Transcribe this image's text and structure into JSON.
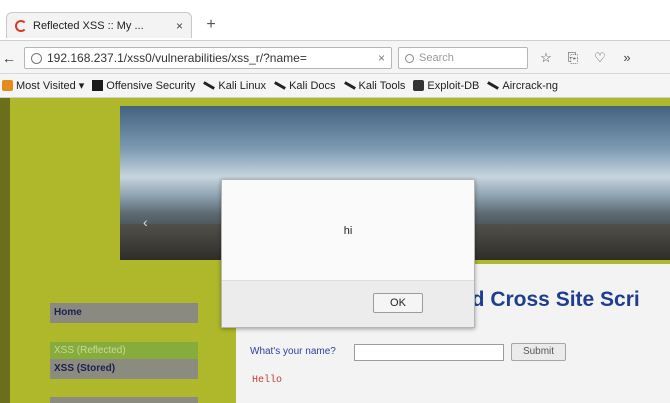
{
  "browser": {
    "tab_title": "Reflected XSS :: My ...",
    "tab_close": "×",
    "new_tab": "+",
    "url": "192.168.237.1/xss0/vulnerabilities/xss_r/?name=",
    "url_clear": "×",
    "search_placeholder": "Search",
    "back": "←",
    "icons": [
      "star-icon",
      "clipboard-icon",
      "pocket-icon",
      "overflow-icon"
    ],
    "icon_glyphs": [
      "☆",
      "⎘",
      "♡",
      "»"
    ]
  },
  "bookmarks": [
    {
      "label": "Most Visited ▾",
      "icon": "most-visited-icon"
    },
    {
      "label": "Offensive Security",
      "icon": "offensive-security-icon"
    },
    {
      "label": "Kali Linux",
      "icon": "kali-icon"
    },
    {
      "label": "Kali Docs",
      "icon": "kali-icon"
    },
    {
      "label": "Kali Tools",
      "icon": "kali-icon"
    },
    {
      "label": "Exploit-DB",
      "icon": "exploit-db-icon"
    },
    {
      "label": "Aircrack-ng",
      "icon": "aircrack-icon"
    }
  ],
  "page": {
    "banner_arrow": "‹",
    "heading": "ed Cross Site Scri",
    "form": {
      "label": "What's your name?",
      "input_value": "",
      "submit_label": "Submit"
    },
    "output": "Hello"
  },
  "menu": {
    "home": "Home",
    "reflected": "XSS (Reflected)",
    "stored": "XSS (Stored)"
  },
  "dialog": {
    "message": "hi",
    "ok_label": "OK"
  },
  "colors": {
    "page_bg": "#aeb82a",
    "heading": "#1e3f8f",
    "hello": "#c33d3d",
    "menu_active": "#86ad3c"
  }
}
